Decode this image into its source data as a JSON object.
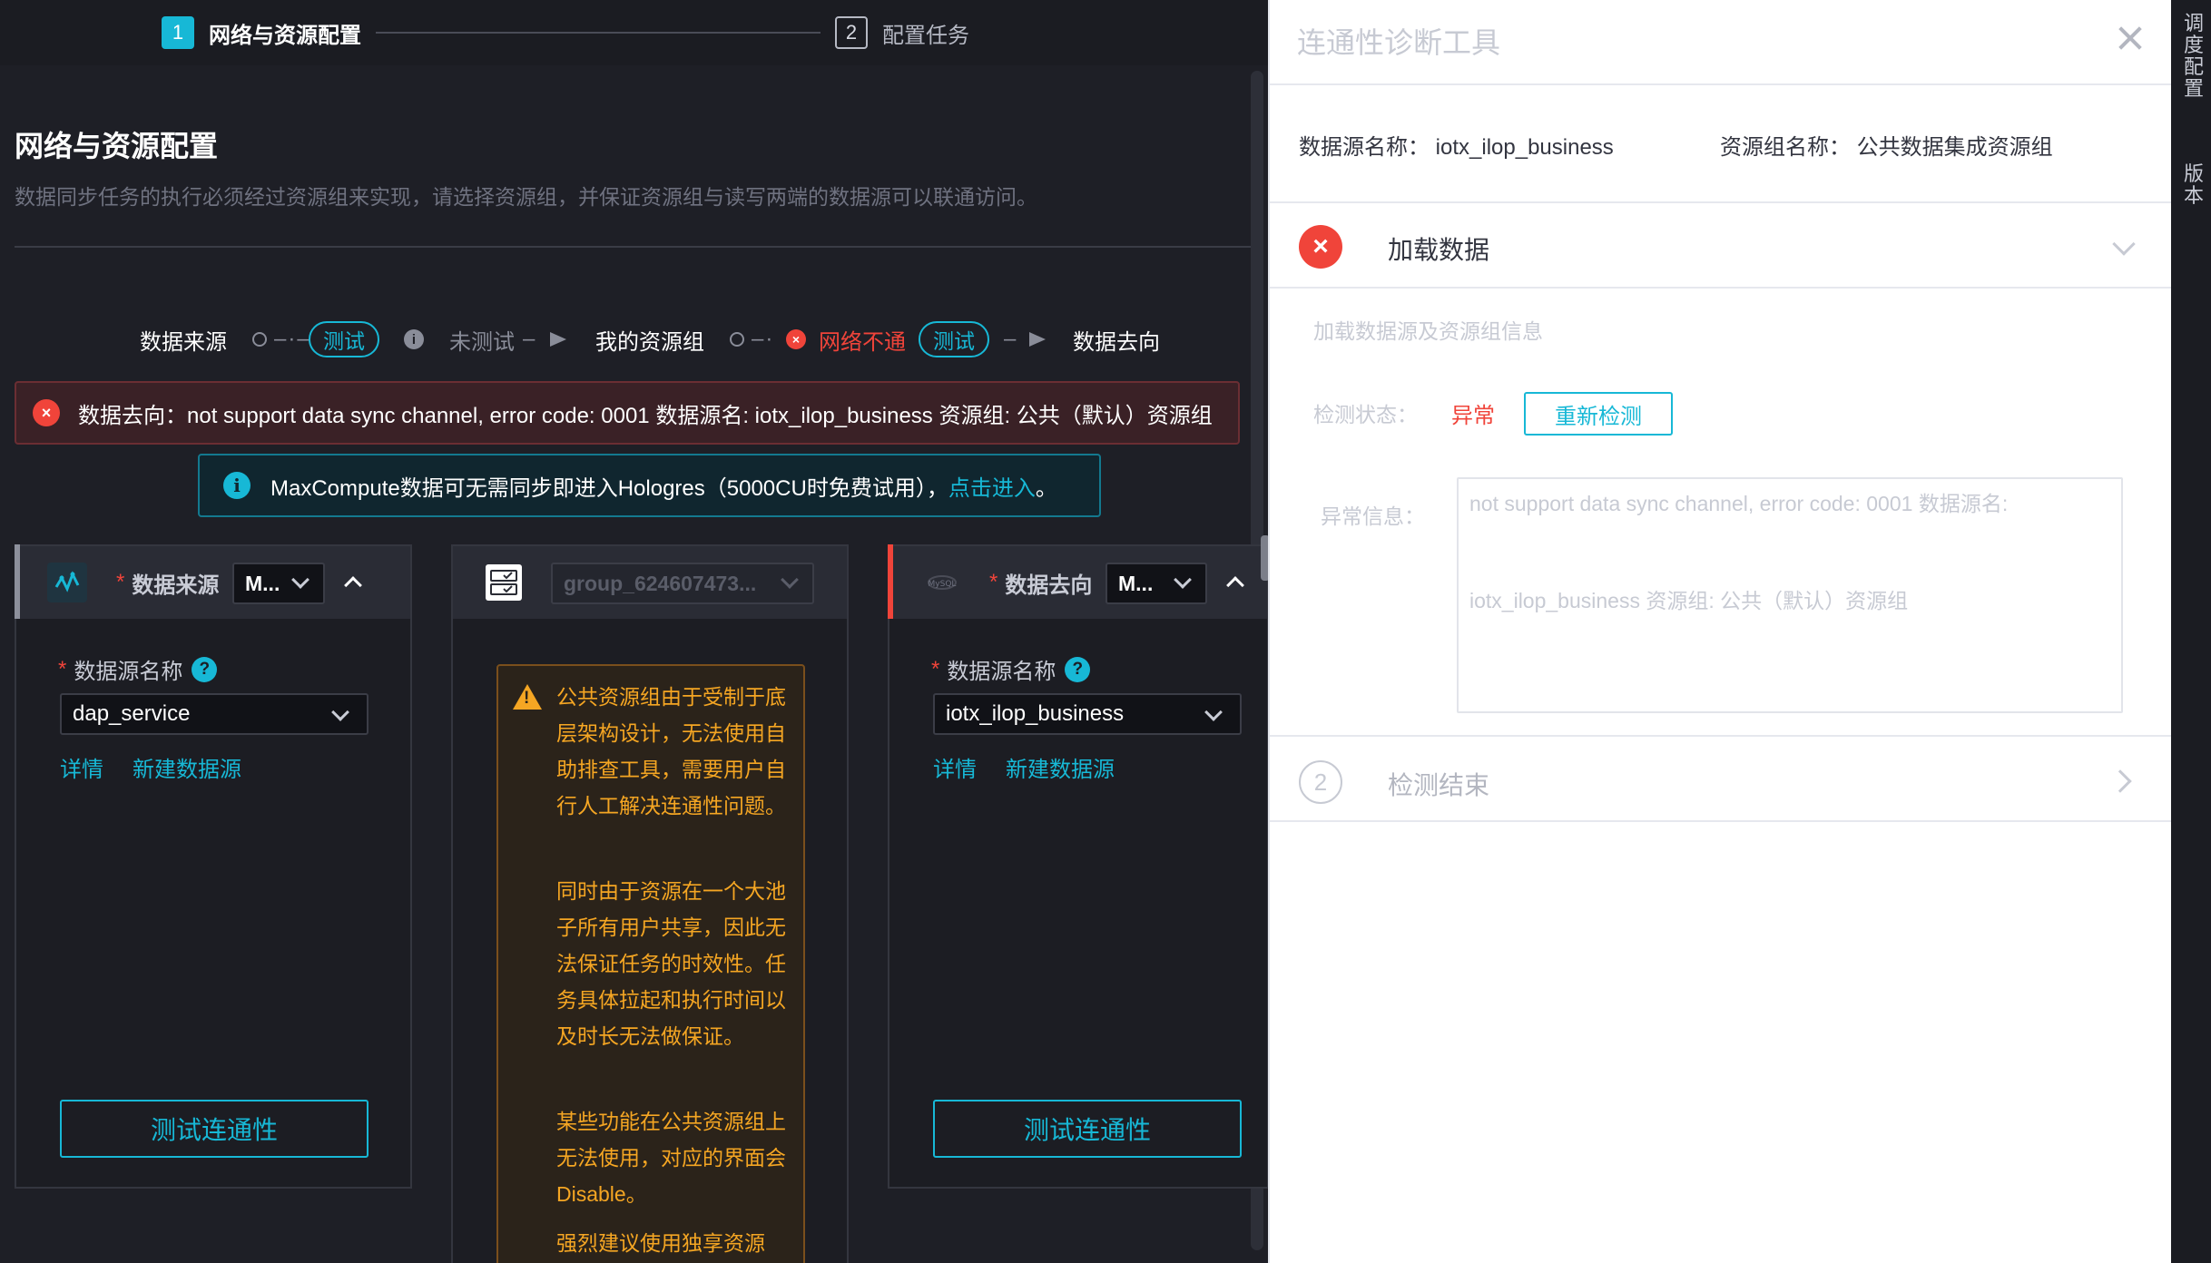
{
  "steps": [
    {
      "num": "1",
      "label": "网络与资源配置"
    },
    {
      "num": "2",
      "label": "配置任务"
    }
  ],
  "section": {
    "title": "网络与资源配置",
    "description": "数据同步任务的执行必须经过资源组来实现，请选择资源组，并保证资源组与读写两端的数据源可以联通访问。"
  },
  "flow": {
    "source": "数据来源",
    "test1": "测试",
    "untested": "未测试",
    "my_group": "我的资源组",
    "net_fail": "网络不通",
    "test2": "测试",
    "target": "数据去向",
    "info_glyph": "i",
    "err_glyph": "×"
  },
  "alerts": {
    "error": "数据去向：not support data sync channel, error code: 0001 数据源名: iotx_ilop_business 资源组: 公共（默认）资源组",
    "info_prefix": "MaxCompute数据可无需同步即进入Hologres（5000CU时免费试用），",
    "info_link": "点击进入",
    "info_suffix": "。"
  },
  "source_card": {
    "req": "*",
    "title": "数据来源",
    "type_value": "M...",
    "field_label": "数据源名称",
    "help": "?",
    "field_value": "dap_service",
    "link_detail": "详情",
    "link_new": "新建数据源",
    "test_button": "测试连通性"
  },
  "group_card": {
    "group_value": "group_624607473...",
    "warning_p1": "公共资源组由于受制于底层架构设计，无法使用自助排查工具，需要用户自行人工解决连通性问题。",
    "warning_p2": "同时由于资源在一个大池子所有用户共享，因此无法保证任务的时效性。任务具体拉起和执行时间以及时长无法做保证。",
    "warning_p3": "某些功能在公共资源组上无法使用，对应的界面会Disable。",
    "warning_p4": "强烈建议使用独享资源"
  },
  "target_card": {
    "req": "*",
    "title": "数据去向",
    "type_value": "M...",
    "field_label": "数据源名称",
    "help": "?",
    "field_value": "iotx_ilop_business",
    "link_detail": "详情",
    "link_new": "新建数据源",
    "test_button": "测试连通性"
  },
  "drawer": {
    "title": "连通性诊断工具",
    "ds_name_label": "数据源名称：",
    "ds_name_value": "iotx_ilop_business",
    "rg_name_label": "资源组名称：",
    "rg_name_value": "公共数据集成资源组",
    "step1_title": "加载数据",
    "step1_desc": "加载数据源及资源组信息",
    "status_label": "检测状态：",
    "status_value": "异常",
    "recheck_button": "重新检测",
    "error_info_label": "异常信息：",
    "error_info_line1": "not support data sync channel, error code: 0001 数据源名:",
    "error_info_line2": "iotx_ilop_business 资源组: 公共（默认）资源组",
    "step2_num": "2",
    "step2_title": "检测结束"
  },
  "strip": {
    "item1": "调度配置",
    "item2": "版本"
  },
  "colors": {
    "accent": "#17b8d6",
    "error": "#f0443a",
    "warning": "#f5a623"
  }
}
